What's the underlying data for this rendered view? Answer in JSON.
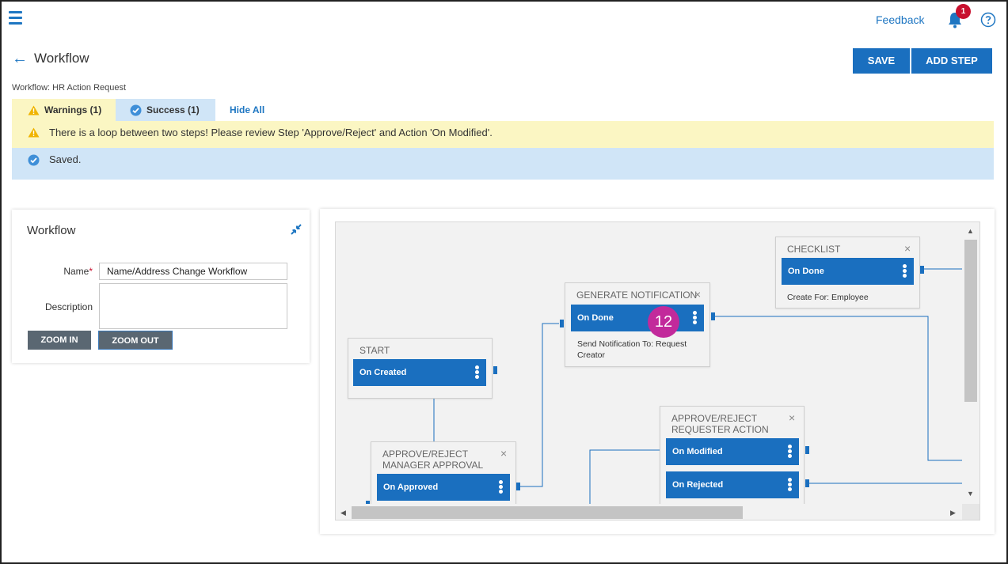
{
  "topbar": {
    "feedback": "Feedback",
    "notification_count": "1"
  },
  "header": {
    "title": "Workflow",
    "save_label": "SAVE",
    "add_step_label": "ADD STEP",
    "subtitle": "Workflow: HR Action Request"
  },
  "tabs": {
    "warnings": "Warnings (1)",
    "success": "Success (1)",
    "hide_all": "Hide All"
  },
  "messages": {
    "warning": "There is a loop between two steps! Please review Step 'Approve/Reject' and Action 'On Modified'.",
    "success": "Saved."
  },
  "form": {
    "title": "Workflow",
    "name_label": "Name",
    "name_required_mark": "*",
    "name_value": "Name/Address Change Workflow",
    "description_label": "Description",
    "description_value": "",
    "zoom_in": "ZOOM IN",
    "zoom_out": "ZOOM OUT"
  },
  "canvas": {
    "nodes": {
      "start": {
        "title": "START",
        "action": "On Created"
      },
      "generate_notification": {
        "title": "GENERATE NOTIFICATION",
        "action": "On Done",
        "note_line1": "Send Notification To: Request",
        "note_line2": "Creator"
      },
      "checklist": {
        "title": "CHECKLIST",
        "action": "On Done",
        "note": "Create For: Employee"
      },
      "manager_approval": {
        "title_line1": "APPROVE/REJECT",
        "title_line2": "MANAGER APPROVAL",
        "action": "On Approved"
      },
      "requester_action": {
        "title_line1": "APPROVE/REJECT",
        "title_line2": "REQUESTER ACTION",
        "action1": "On Modified",
        "action2": "On Rejected"
      }
    },
    "step_badge": "12",
    "close_glyph": "×"
  },
  "colors": {
    "primary": "#1a6fbf",
    "link": "#1e76c2",
    "warning_bg": "#fbf6c3",
    "success_bg": "#d0e5f7",
    "badge": "#c22a9b",
    "notification_badge": "#c8102e"
  }
}
